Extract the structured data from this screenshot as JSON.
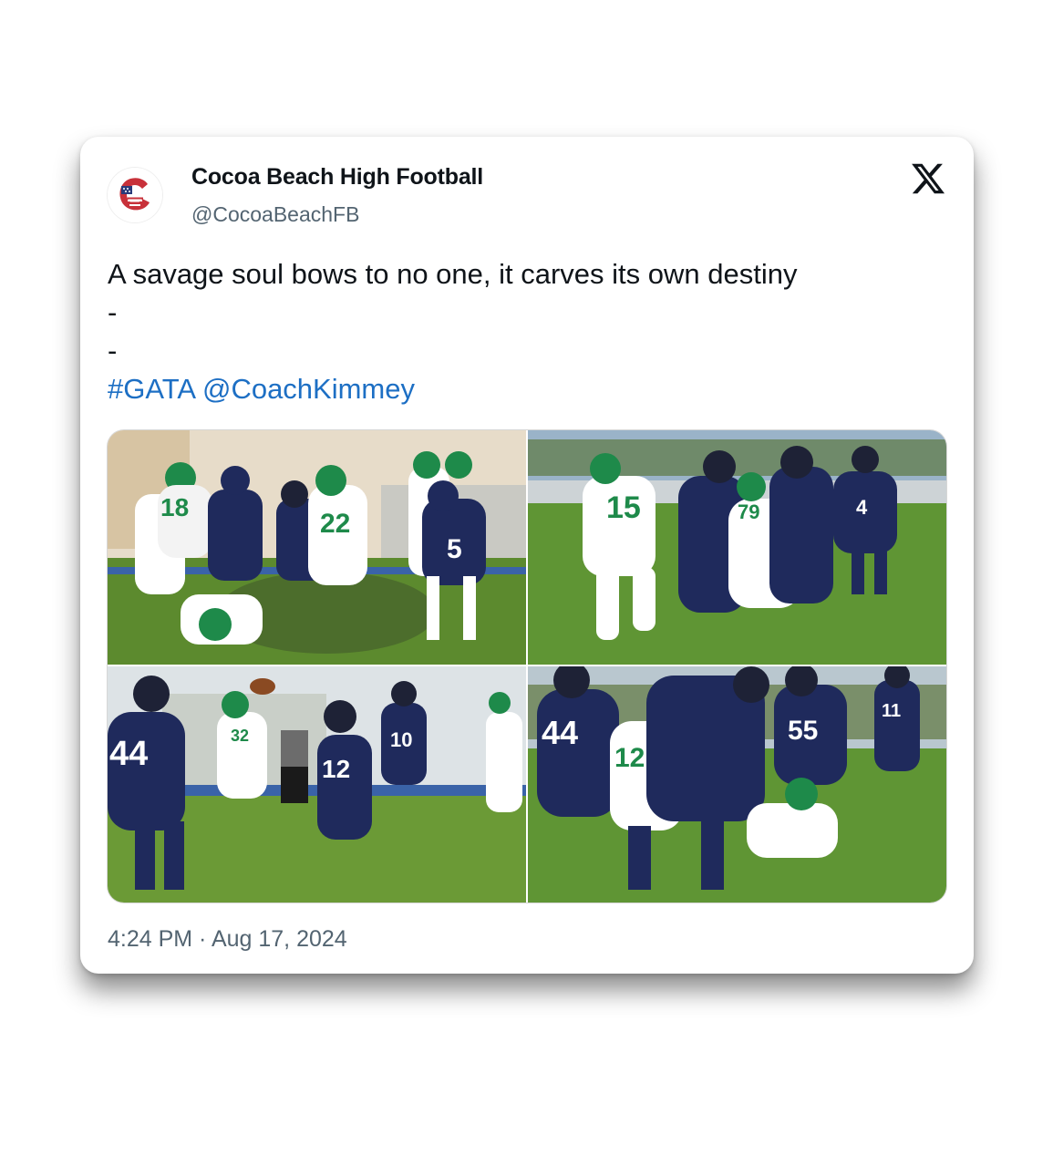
{
  "author": {
    "display_name": "Cocoa Beach High Football",
    "handle": "@CocoaBeachFB"
  },
  "icons": {
    "avatar": "flag-c-logo",
    "platform": "x-logo-icon"
  },
  "tweet": {
    "text_line_1": "A savage soul bows to no one, it carves its own destiny",
    "text_line_2": "-",
    "text_line_3": "-",
    "hashtag": "#GATA",
    "mention": "@CoachKimmey"
  },
  "media": {
    "photos": [
      {
        "jersey_numbers": [
          "18",
          "22",
          "5"
        ]
      },
      {
        "jersey_numbers": [
          "15",
          "79",
          "4"
        ]
      },
      {
        "jersey_numbers": [
          "44",
          "32",
          "10",
          "12"
        ]
      },
      {
        "jersey_numbers": [
          "44",
          "12",
          "55",
          "11"
        ]
      }
    ]
  },
  "footer": {
    "timestamp": "4:24 PM · Aug 17, 2024"
  },
  "colors": {
    "text": "#0f1419",
    "secondary_text": "#536471",
    "link": "#1d6fc4",
    "navy_jersey": "#1f2a5c",
    "green_helmet": "#1e8a4a",
    "field_grass": "#5c8a2e"
  }
}
